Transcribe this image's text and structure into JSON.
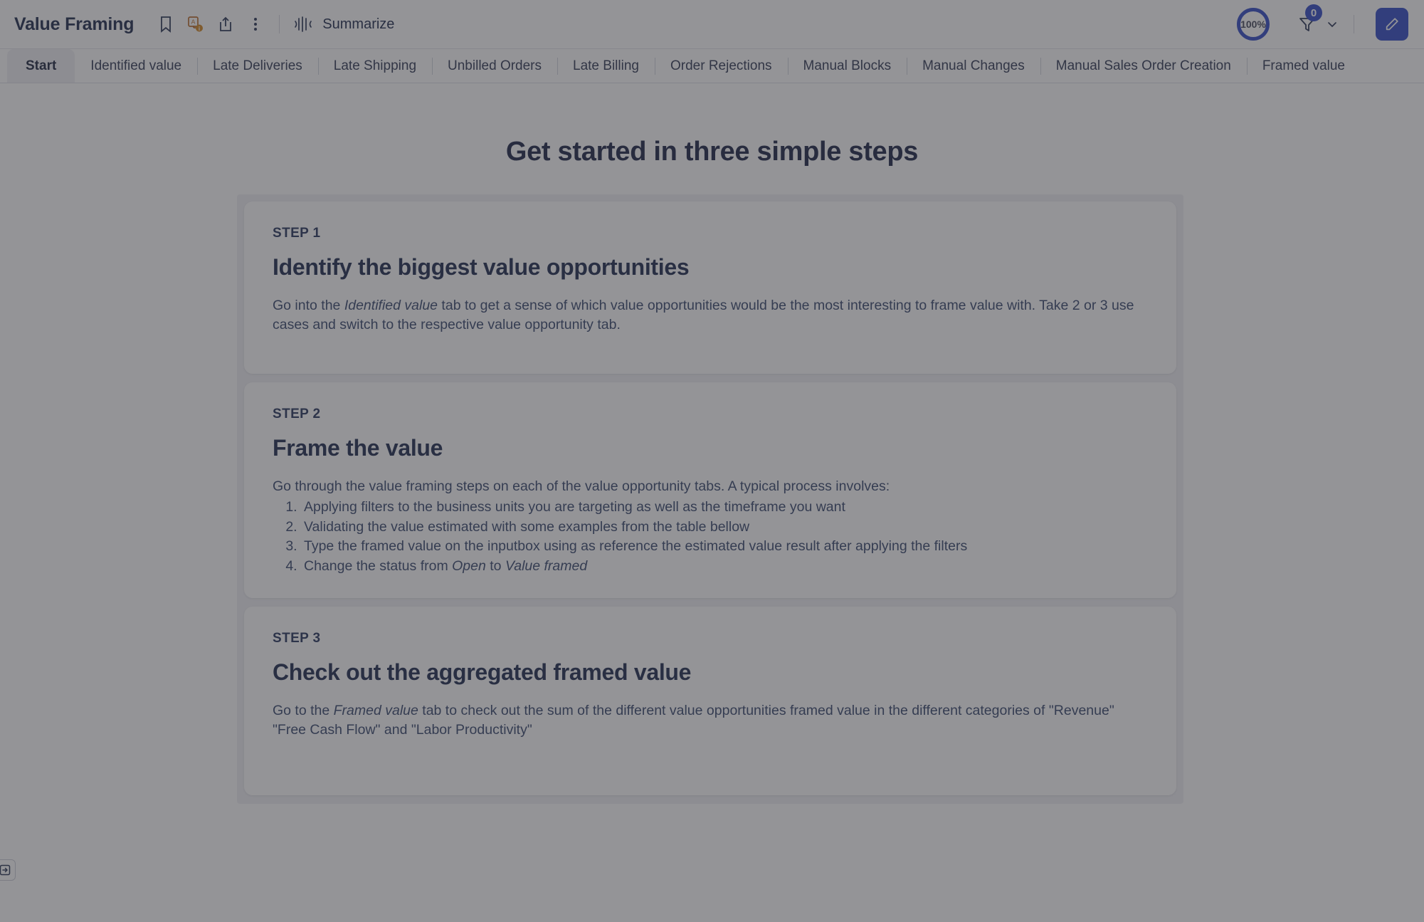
{
  "toolbar": {
    "doc_title": "Value Framing",
    "icons": [
      {
        "name": "bookmark-icon"
      },
      {
        "name": "translate-icon"
      },
      {
        "name": "share-icon"
      },
      {
        "name": "more-options-icon"
      }
    ],
    "summarize_icon": "waveform-icon",
    "summarize_label": "Summarize",
    "zoom_percent": "100%",
    "filter_icon": "filter-icon",
    "filter_count": "0",
    "filter_chevron": "chevron-down-icon",
    "edit_icon": "pencil-icon",
    "accent_color": "#2641c4",
    "title_color": "#132043"
  },
  "tabs": [
    {
      "label": "Start",
      "active": true
    },
    {
      "label": "Identified value",
      "active": false
    },
    {
      "label": "Late Deliveries",
      "active": false
    },
    {
      "label": "Late Shipping",
      "active": false
    },
    {
      "label": "Unbilled Orders",
      "active": false
    },
    {
      "label": "Late Billing",
      "active": false
    },
    {
      "label": "Order Rejections",
      "active": false
    },
    {
      "label": "Manual Blocks",
      "active": false
    },
    {
      "label": "Manual Changes",
      "active": false
    },
    {
      "label": "Manual Sales Order Creation",
      "active": false
    },
    {
      "label": "Framed value",
      "active": false
    }
  ],
  "main": {
    "heading": "Get started in three simple steps",
    "cards": [
      {
        "kicker": "STEP 1",
        "title": "Identify the biggest value opportunities",
        "body_parts": [
          {
            "text": "Go into the ",
            "italic": false
          },
          {
            "text": "Identified value",
            "italic": true
          },
          {
            "text": " tab to get a sense of which value opportunities would be the most interesting to frame value with. Take 2 or 3 use cases and switch to the respective value opportunity tab.",
            "italic": false
          }
        ],
        "list": []
      },
      {
        "kicker": "STEP 2",
        "title": "Frame the value",
        "body_parts": [
          {
            "text": "Go through the value framing steps on each of the value opportunity tabs. A typical process involves:",
            "italic": false
          }
        ],
        "list": [
          [
            {
              "text": "Applying filters to the business units you are targeting as well as the timeframe you want",
              "italic": false
            }
          ],
          [
            {
              "text": "Validating the value estimated with some examples from the table bellow",
              "italic": false
            }
          ],
          [
            {
              "text": "Type the framed value on the inputbox using as reference the estimated value result after applying the filters",
              "italic": false
            }
          ],
          [
            {
              "text": "Change the status from ",
              "italic": false
            },
            {
              "text": "Open",
              "italic": true
            },
            {
              "text": " to ",
              "italic": false
            },
            {
              "text": "Value framed",
              "italic": true
            }
          ]
        ]
      },
      {
        "kicker": "STEP 3",
        "title": "Check out the aggregated framed value",
        "body_parts": [
          {
            "text": "Go to the ",
            "italic": false
          },
          {
            "text": "Framed value",
            "italic": true
          },
          {
            "text": " tab to check out the sum of the different value opportunities framed value in the different categories of \"Revenue\" \"Free Cash Flow\" and \"Labor Productivity\"",
            "italic": false
          }
        ],
        "list": []
      }
    ]
  },
  "bottom": {
    "collapse_icon": "expand-panel-icon"
  }
}
